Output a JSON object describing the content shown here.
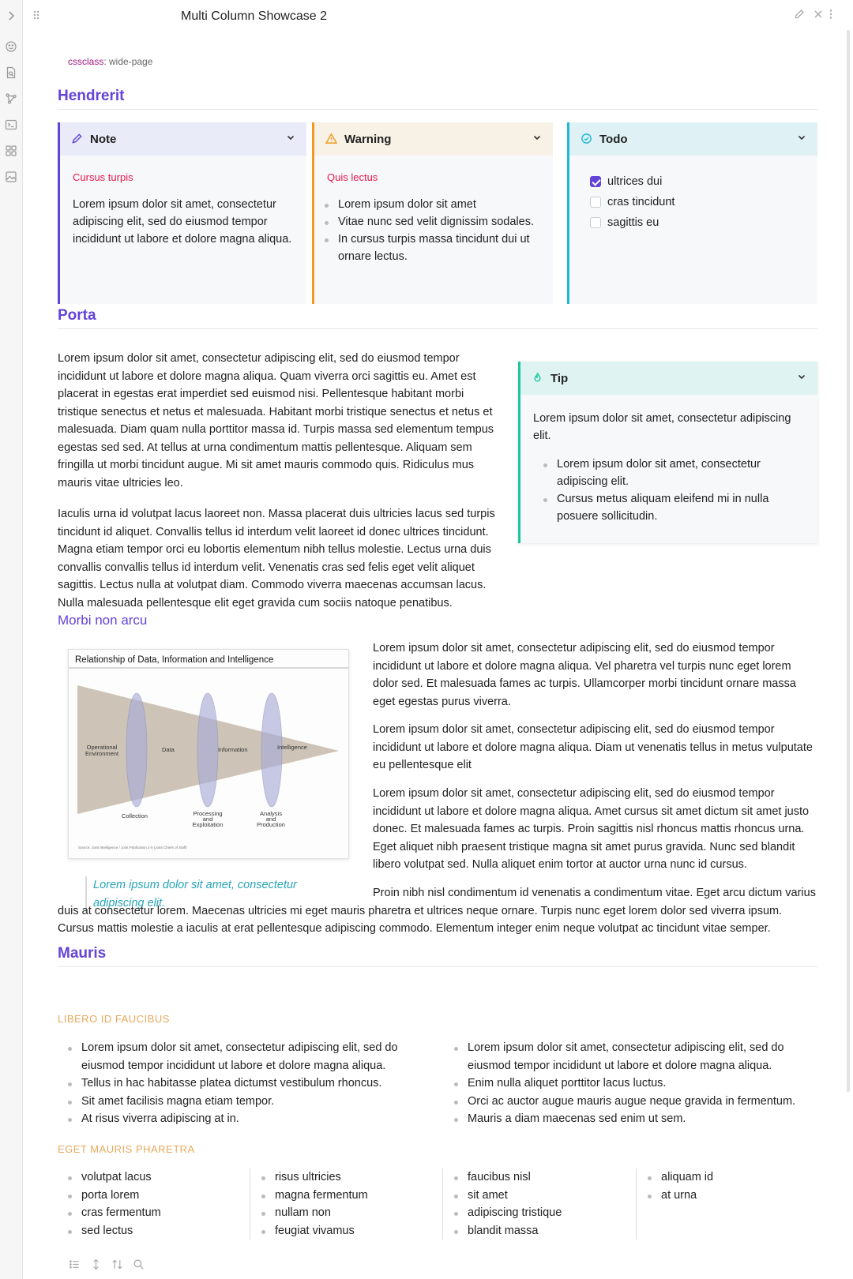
{
  "window": {
    "title": "Multi Column Showcase 2",
    "ribbon_icons": [
      "chevron-right-icon",
      "smiley-icon",
      "file-search-icon",
      "graph-icon",
      "terminal-icon",
      "grid-icon",
      "image-icon"
    ],
    "header_actions": [
      "pencil-icon",
      "close-icon",
      "more-vertical-icon"
    ]
  },
  "frontmatter": {
    "key": "cssclass",
    "value": "wide-page"
  },
  "sections": {
    "hendrerit": {
      "heading": "Hendrerit",
      "callouts": [
        {
          "type": "Note",
          "color": "#6443d8",
          "header_bg": "#e9ebf8",
          "icon": "pencil-icon",
          "subtitle": "Cursus turpis",
          "text": "Lorem ipsum dolor sit amet, consectetur adipiscing elit, sed do eiusmod tempor incididunt ut labore et dolore magna aliqua."
        },
        {
          "type": "Warning",
          "color": "#f29a1f",
          "header_bg": "#f8f1e5",
          "icon": "warning-icon",
          "subtitle": "Quis lectus",
          "items": [
            "Lorem ipsum dolor sit amet",
            "Vitae nunc sed velit dignissim sodales.",
            "In cursus turpis massa tincidunt dui ut ornare lectus."
          ]
        },
        {
          "type": "Todo",
          "color": "#1fb8d6",
          "header_bg": "#dff1f5",
          "icon": "check-circle-icon",
          "tasks": [
            {
              "label": "ultrices dui",
              "done": true
            },
            {
              "label": "cras tincidunt",
              "done": false
            },
            {
              "label": "sagittis eu",
              "done": false
            }
          ]
        }
      ]
    },
    "porta": {
      "heading": "Porta",
      "p1": "Lorem ipsum dolor sit amet, consectetur adipiscing elit, sed do eiusmod tempor incididunt ut labore et dolore magna aliqua. Quam viverra orci sagittis eu. Amet est placerat in egestas erat imperdiet sed euismod nisi. Pellentesque habitant morbi tristique senectus et netus et malesuada. Habitant morbi tristique senectus et netus et malesuada. Diam quam nulla porttitor massa id. Turpis massa sed elementum tempus egestas sed sed. At tellus at urna condimentum mattis pellentesque. Aliquam sem fringilla ut morbi tincidunt augue. Mi sit amet mauris commodo quis. Ridiculus mus mauris vitae ultricies leo.",
      "p2": "Iaculis urna id volutpat lacus laoreet non. Massa placerat duis ultricies lacus sed turpis tincidunt id aliquet. Convallis tellus id interdum velit laoreet id donec ultrices tincidunt. Magna etiam tempor orci eu lobortis elementum nibh tellus molestie. Lectus urna duis convallis convallis tellus id interdum velit. Venenatis cras sed felis eget velit aliquet sagittis. Lectus nulla at volutpat diam. Commodo viverra maecenas accumsan lacus. Nulla malesuada pellentesque elit eget gravida cum sociis natoque penatibus.",
      "tip": {
        "type": "Tip",
        "color": "#1cc7a0",
        "header_bg": "#dff4f2",
        "icon": "flame-icon",
        "text": "Lorem ipsum dolor sit amet, consectetur adipiscing elit.",
        "items": [
          "Lorem ipsum dolor sit amet, consectetur adipiscing elit.",
          "Cursus metus aliquam eleifend mi in nulla posuere sollicitudin."
        ]
      }
    },
    "morbi": {
      "heading": "Morbi non arcu",
      "figure": {
        "title": "Relationship of Data, Information and Intelligence",
        "labels": {
          "operational": [
            "Operational",
            "Environment"
          ],
          "data": "Data",
          "information": "Information",
          "intelligence": "Intelligence",
          "collection": "Collection",
          "processing": [
            "Processing",
            "and",
            "Exploitation"
          ],
          "analysis": [
            "Analysis",
            "and",
            "Production"
          ]
        },
        "source": "Source:  Joint Intelligence / Joint Publication 2-0  (Joint Chiefs of Staff)"
      },
      "caption": "Lorem ipsum dolor sit amet, consectetur adipiscing elit.",
      "p1": "Lorem ipsum dolor sit amet, consectetur adipiscing elit, sed do eiusmod tempor incididunt ut labore et dolore magna aliqua. Vel pharetra vel turpis nunc eget lorem dolor sed. Et malesuada fames ac turpis. Ullamcorper morbi tincidunt ornare massa eget egestas purus viverra.",
      "p2": "Lorem ipsum dolor sit amet, consectetur adipiscing elit, sed do eiusmod tempor incididunt ut labore et dolore magna aliqua. Diam ut venenatis tellus in metus vulputate eu pellentesque elit",
      "p3": "Lorem ipsum dolor sit amet, consectetur adipiscing elit, sed do eiusmod tempor incididunt ut labore et dolore magna aliqua. Amet cursus sit amet dictum sit amet justo donec. Et malesuada fames ac turpis. Proin sagittis nisl rhoncus mattis rhoncus urna. Eget aliquet nibh praesent tristique magna sit amet purus gravida. Nunc sed blandit libero volutpat sed. Nulla aliquet enim tortor at auctor urna nunc id cursus.",
      "p4": "Proin nibh nisl condimentum id venenatis a condimentum vitae. Eget arcu dictum varius duis at consectetur lorem. Maecenas ultricies mi eget mauris pharetra et ultrices neque ornare. Turpis nunc eget lorem dolor sed viverra ipsum. Cursus mattis molestie a iaculis at erat pellentesque adipiscing commodo. Elementum integer enim neque volutpat ac tincidunt vitae semper."
    },
    "mauris": {
      "heading": "Mauris",
      "sub1": "LIBERO ID FAUCIBUS",
      "col_left": [
        "Lorem ipsum dolor sit amet, consectetur adipiscing elit, sed do eiusmod tempor incididunt ut labore et dolore magna aliqua.",
        "Tellus in hac habitasse platea dictumst vestibulum rhoncus.",
        "Sit amet facilisis magna etiam tempor.",
        "At risus viverra adipiscing at in."
      ],
      "col_right": [
        "Lorem ipsum dolor sit amet, consectetur adipiscing elit, sed do eiusmod tempor incididunt ut labore et dolore magna aliqua.",
        "Enim nulla aliquet porttitor lacus luctus.",
        "Orci ac auctor augue mauris augue neque gravida in fermentum.",
        "Mauris a diam maecenas sed enim ut sem."
      ],
      "sub2": "EGET MAURIS PHARETRA",
      "cols4": [
        [
          "volutpat lacus",
          "porta lorem",
          "cras fermentum",
          "sed lectus"
        ],
        [
          "risus ultricies",
          "magna fermentum",
          "nullam non",
          "feugiat vivamus"
        ],
        [
          "faucibus nisl",
          "sit amet",
          "adipiscing tristique",
          "blandit massa"
        ],
        [
          "aliquam id",
          "at urna"
        ]
      ]
    }
  },
  "footer_icons": [
    "list-icon",
    "arrows-vertical-icon",
    "sort-icon",
    "search-icon"
  ]
}
